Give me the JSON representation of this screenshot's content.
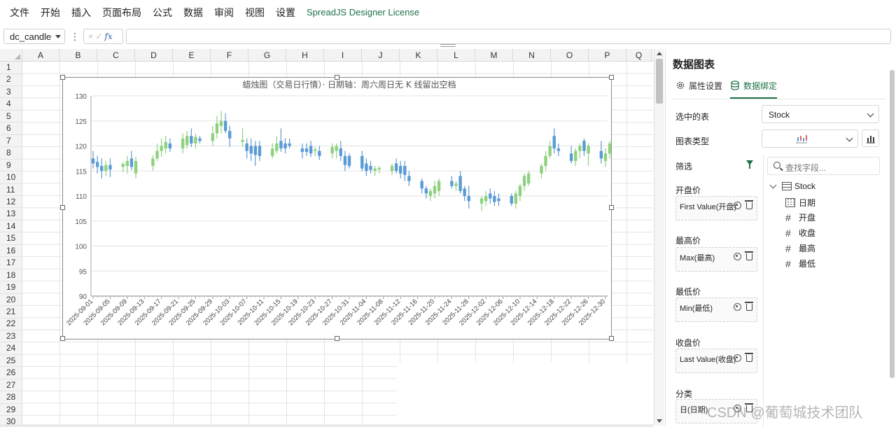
{
  "menu": {
    "items": [
      "文件",
      "开始",
      "插入",
      "页面布局",
      "公式",
      "数据",
      "审阅",
      "视图",
      "设置"
    ],
    "license": "SpreadJS Designer License"
  },
  "formula_bar": {
    "name_box": "dc_candle",
    "dots": "⋮",
    "cancel": "×",
    "confirm": "✓",
    "fx": "fx",
    "formula": ""
  },
  "sheet": {
    "columns": [
      "A",
      "B",
      "C",
      "D",
      "E",
      "F",
      "G",
      "H",
      "I",
      "J",
      "K",
      "L",
      "M",
      "N",
      "O",
      "P",
      "Q"
    ],
    "rows": [
      "1",
      "2",
      "3",
      "4",
      "5",
      "6",
      "7",
      "8",
      "9",
      "10",
      "11",
      "12",
      "13",
      "14",
      "15",
      "16",
      "17",
      "18",
      "19",
      "20",
      "21",
      "22",
      "23",
      "24",
      "25",
      "26",
      "27",
      "28",
      "29",
      "30"
    ]
  },
  "chart_data": {
    "type": "candlestick",
    "title": "蜡烛图（交易日行情）· 日期轴：周六周日无 K 线留出空档",
    "ylim": [
      90,
      130
    ],
    "y_ticks": [
      90,
      95,
      100,
      105,
      110,
      115,
      120,
      125,
      130
    ],
    "x_ticks": [
      "2025-09-01",
      "2025-09-05",
      "2025-09-09",
      "2025-09-13",
      "2025-09-17",
      "2025-09-21",
      "2025-09-25",
      "2025-09-29",
      "2025-10-03",
      "2025-10-07",
      "2025-10-11",
      "2025-10-15",
      "2025-10-19",
      "2025-10-23",
      "2025-10-27",
      "2025-10-31",
      "2025-11-04",
      "2025-11-08",
      "2025-11-12",
      "2025-11-16",
      "2025-11-20",
      "2025-11-24",
      "2025-11-28",
      "2025-12-02",
      "2025-12-06",
      "2025-12-10",
      "2025-12-14",
      "2025-12-18",
      "2025-12-22",
      "2025-12-26",
      "2025-12-30"
    ],
    "date_start": "2025-09-01",
    "colors": {
      "up": "#8fd17f",
      "down": "#5b9bd5",
      "grid": "#e3e3e3",
      "axis": "#555555"
    },
    "candles": [
      {
        "d": "2025-09-01",
        "o": 117.5,
        "h": 119,
        "l": 115.5,
        "c": 116.5
      },
      {
        "d": "2025-09-02",
        "o": 116.8,
        "h": 118,
        "l": 114.5,
        "c": 115.8
      },
      {
        "d": "2025-09-03",
        "o": 116.0,
        "h": 117.5,
        "l": 113.5,
        "c": 115.0
      },
      {
        "d": "2025-09-04",
        "o": 115.0,
        "h": 117.0,
        "l": 114.0,
        "c": 116.2
      },
      {
        "d": "2025-09-05",
        "o": 116.2,
        "h": 117.5,
        "l": 113.8,
        "c": 115.3
      },
      {
        "d": "2025-09-08",
        "o": 115.8,
        "h": 116.8,
        "l": 114.8,
        "c": 116.4
      },
      {
        "d": "2025-09-09",
        "o": 116.0,
        "h": 118.0,
        "l": 114.5,
        "c": 117.0
      },
      {
        "d": "2025-09-10",
        "o": 117.5,
        "h": 119.0,
        "l": 115.2,
        "c": 115.8
      },
      {
        "d": "2025-09-11",
        "o": 114.5,
        "h": 117.8,
        "l": 113.5,
        "c": 117.0
      },
      {
        "d": "2025-09-15",
        "o": 116.0,
        "h": 118.2,
        "l": 115.0,
        "c": 117.5
      },
      {
        "d": "2025-09-16",
        "o": 117.5,
        "h": 120.5,
        "l": 117.0,
        "c": 119.0
      },
      {
        "d": "2025-09-17",
        "o": 119.0,
        "h": 121.5,
        "l": 117.8,
        "c": 120.0
      },
      {
        "d": "2025-09-18",
        "o": 119.5,
        "h": 122.0,
        "l": 118.5,
        "c": 120.8
      },
      {
        "d": "2025-09-19",
        "o": 120.5,
        "h": 121.5,
        "l": 118.8,
        "c": 119.5
      },
      {
        "d": "2025-09-22",
        "o": 119.5,
        "h": 122.5,
        "l": 118.5,
        "c": 121.5
      },
      {
        "d": "2025-09-23",
        "o": 120.2,
        "h": 123.0,
        "l": 119.5,
        "c": 122.0
      },
      {
        "d": "2025-09-24",
        "o": 122.0,
        "h": 123.5,
        "l": 119.8,
        "c": 120.5
      },
      {
        "d": "2025-09-25",
        "o": 120.5,
        "h": 122.5,
        "l": 119.5,
        "c": 121.8
      },
      {
        "d": "2025-09-26",
        "o": 121.5,
        "h": 122.0,
        "l": 120.5,
        "c": 121.0
      },
      {
        "d": "2025-09-29",
        "o": 121.0,
        "h": 124.0,
        "l": 120.0,
        "c": 122.5
      },
      {
        "d": "2025-09-30",
        "o": 122.5,
        "h": 126.0,
        "l": 121.5,
        "c": 124.5
      },
      {
        "d": "2025-10-01",
        "o": 124.0,
        "h": 127.0,
        "l": 122.5,
        "c": 125.0
      },
      {
        "d": "2025-10-02",
        "o": 125.0,
        "h": 126.5,
        "l": 122.5,
        "c": 123.0
      },
      {
        "d": "2025-10-03",
        "o": 123.0,
        "h": 124.0,
        "l": 119.8,
        "c": 121.5
      },
      {
        "d": "2025-10-06",
        "o": 120.8,
        "h": 123.5,
        "l": 119.8,
        "c": 121.2
      },
      {
        "d": "2025-10-07",
        "o": 120.5,
        "h": 121.5,
        "l": 117.5,
        "c": 119.0
      },
      {
        "d": "2025-10-08",
        "o": 120.0,
        "h": 121.5,
        "l": 117.0,
        "c": 118.5
      },
      {
        "d": "2025-10-09",
        "o": 120.0,
        "h": 121.0,
        "l": 116.0,
        "c": 118.2
      },
      {
        "d": "2025-10-10",
        "o": 120.0,
        "h": 121.0,
        "l": 117.0,
        "c": 118.0
      },
      {
        "d": "2025-10-13",
        "o": 118.0,
        "h": 120.5,
        "l": 117.5,
        "c": 119.5
      },
      {
        "d": "2025-10-14",
        "o": 119.0,
        "h": 122.0,
        "l": 118.5,
        "c": 120.5
      },
      {
        "d": "2025-10-15",
        "o": 121.0,
        "h": 123.5,
        "l": 118.8,
        "c": 119.5
      },
      {
        "d": "2025-10-16",
        "o": 120.5,
        "h": 121.5,
        "l": 118.5,
        "c": 119.5
      },
      {
        "d": "2025-10-17",
        "o": 120.5,
        "h": 121.5,
        "l": 119.5,
        "c": 120.0
      },
      {
        "d": "2025-10-20",
        "o": 119.5,
        "h": 120.5,
        "l": 117.5,
        "c": 118.8
      },
      {
        "d": "2025-10-21",
        "o": 119.5,
        "h": 120.5,
        "l": 118.0,
        "c": 118.8
      },
      {
        "d": "2025-10-22",
        "o": 120.0,
        "h": 121.0,
        "l": 117.8,
        "c": 118.5
      },
      {
        "d": "2025-10-23",
        "o": 119.0,
        "h": 119.8,
        "l": 118.0,
        "c": 119.3
      },
      {
        "d": "2025-10-24",
        "o": 119.0,
        "h": 120.0,
        "l": 117.2,
        "c": 118.0
      },
      {
        "d": "2025-10-27",
        "o": 118.5,
        "h": 120.5,
        "l": 117.5,
        "c": 119.8
      },
      {
        "d": "2025-10-28",
        "o": 119.0,
        "h": 120.5,
        "l": 117.5,
        "c": 120.0
      },
      {
        "d": "2025-10-29",
        "o": 119.5,
        "h": 121.0,
        "l": 117.0,
        "c": 118.0
      },
      {
        "d": "2025-10-30",
        "o": 118.0,
        "h": 119.0,
        "l": 115.0,
        "c": 116.2
      },
      {
        "d": "2025-10-31",
        "o": 118.0,
        "h": 118.5,
        "l": 115.5,
        "c": 116.0
      },
      {
        "d": "2025-11-03",
        "o": 118.0,
        "h": 119.0,
        "l": 115.0,
        "c": 115.5
      },
      {
        "d": "2025-11-04",
        "o": 116.5,
        "h": 117.5,
        "l": 114.0,
        "c": 115.0
      },
      {
        "d": "2025-11-05",
        "o": 116.0,
        "h": 117.0,
        "l": 114.5,
        "c": 115.2
      },
      {
        "d": "2025-11-06",
        "o": 115.0,
        "h": 116.0,
        "l": 114.0,
        "c": 115.5
      },
      {
        "d": "2025-11-07",
        "o": 115.3,
        "h": 116.0,
        "l": 114.5,
        "c": 115.6
      },
      {
        "d": "2025-11-10",
        "o": 115.0,
        "h": 116.5,
        "l": 114.2,
        "c": 116.0
      },
      {
        "d": "2025-11-11",
        "o": 116.5,
        "h": 117.5,
        "l": 114.5,
        "c": 115.0
      },
      {
        "d": "2025-11-12",
        "o": 116.0,
        "h": 117.0,
        "l": 113.5,
        "c": 114.5
      },
      {
        "d": "2025-11-13",
        "o": 116.0,
        "h": 117.0,
        "l": 113.0,
        "c": 114.2
      },
      {
        "d": "2025-11-14",
        "o": 114.0,
        "h": 115.0,
        "l": 112.0,
        "c": 113.0
      },
      {
        "d": "2025-11-17",
        "o": 113.0,
        "h": 113.5,
        "l": 110.5,
        "c": 111.5
      },
      {
        "d": "2025-11-18",
        "o": 111.5,
        "h": 112.0,
        "l": 109.5,
        "c": 110.5
      },
      {
        "d": "2025-11-19",
        "o": 110.0,
        "h": 111.5,
        "l": 109.0,
        "c": 111.0
      },
      {
        "d": "2025-11-20",
        "o": 110.5,
        "h": 113.0,
        "l": 109.5,
        "c": 112.0
      },
      {
        "d": "2025-11-21",
        "o": 111.0,
        "h": 113.5,
        "l": 110.0,
        "c": 113.0
      },
      {
        "d": "2025-11-24",
        "o": 113.0,
        "h": 114.0,
        "l": 111.5,
        "c": 112.0
      },
      {
        "d": "2025-11-25",
        "o": 112.0,
        "h": 113.0,
        "l": 111.0,
        "c": 112.5
      },
      {
        "d": "2025-11-26",
        "o": 114.0,
        "h": 115.0,
        "l": 110.5,
        "c": 111.0
      },
      {
        "d": "2025-11-27",
        "o": 111.5,
        "h": 112.0,
        "l": 109.0,
        "c": 110.0
      },
      {
        "d": "2025-11-28",
        "o": 110.0,
        "h": 112.0,
        "l": 107.5,
        "c": 109.0
      },
      {
        "d": "2025-12-01",
        "o": 108.5,
        "h": 110.0,
        "l": 107.0,
        "c": 109.5
      },
      {
        "d": "2025-12-02",
        "o": 109.0,
        "h": 111.0,
        "l": 108.0,
        "c": 110.0
      },
      {
        "d": "2025-12-03",
        "o": 110.5,
        "h": 111.5,
        "l": 108.5,
        "c": 109.5
      },
      {
        "d": "2025-12-04",
        "o": 110.0,
        "h": 111.0,
        "l": 108.0,
        "c": 108.8
      },
      {
        "d": "2025-12-05",
        "o": 109.5,
        "h": 110.5,
        "l": 108.0,
        "c": 109.0
      },
      {
        "d": "2025-12-08",
        "o": 110.0,
        "h": 110.5,
        "l": 108.0,
        "c": 108.5
      },
      {
        "d": "2025-12-09",
        "o": 108.5,
        "h": 111.0,
        "l": 107.5,
        "c": 110.5
      },
      {
        "d": "2025-12-10",
        "o": 110.0,
        "h": 112.5,
        "l": 109.0,
        "c": 112.0
      },
      {
        "d": "2025-12-11",
        "o": 112.0,
        "h": 114.5,
        "l": 111.0,
        "c": 114.0
      },
      {
        "d": "2025-12-12",
        "o": 112.5,
        "h": 115.0,
        "l": 112.0,
        "c": 114.5
      },
      {
        "d": "2025-12-15",
        "o": 114.5,
        "h": 116.5,
        "l": 113.5,
        "c": 116.0
      },
      {
        "d": "2025-12-16",
        "o": 116.0,
        "h": 119.0,
        "l": 115.0,
        "c": 118.0
      },
      {
        "d": "2025-12-17",
        "o": 118.0,
        "h": 121.0,
        "l": 117.5,
        "c": 120.0
      },
      {
        "d": "2025-12-18",
        "o": 122.0,
        "h": 123.5,
        "l": 118.5,
        "c": 119.5
      },
      {
        "d": "2025-12-19",
        "o": 119.5,
        "h": 120.5,
        "l": 118.0,
        "c": 119.0
      },
      {
        "d": "2025-12-22",
        "o": 118.5,
        "h": 120.0,
        "l": 116.5,
        "c": 117.0
      },
      {
        "d": "2025-12-23",
        "o": 117.0,
        "h": 119.5,
        "l": 116.0,
        "c": 119.0
      },
      {
        "d": "2025-12-24",
        "o": 119.0,
        "h": 120.5,
        "l": 117.5,
        "c": 120.0
      },
      {
        "d": "2025-12-25",
        "o": 121.0,
        "h": 121.5,
        "l": 118.0,
        "c": 119.0
      },
      {
        "d": "2025-12-26",
        "o": 118.5,
        "h": 120.5,
        "l": 116.0,
        "c": 120.0
      },
      {
        "d": "2025-12-29",
        "o": 119.0,
        "h": 121.0,
        "l": 116.5,
        "c": 117.5
      },
      {
        "d": "2025-12-30",
        "o": 117.0,
        "h": 119.5,
        "l": 115.8,
        "c": 118.5
      },
      {
        "d": "2025-12-31",
        "o": 118.5,
        "h": 121.0,
        "l": 117.5,
        "c": 120.5
      }
    ]
  },
  "panel": {
    "title": "数据图表",
    "tabs": [
      "属性设置",
      "数据绑定"
    ],
    "selected_table_label": "选中的表",
    "selected_table_value": "Stock",
    "chart_type_label": "图表类型",
    "filter_label": "筛选",
    "search_placeholder": "查找字段...",
    "tree_root": "Stock",
    "fields": [
      "日期",
      "开盘",
      "收盘",
      "最高",
      "最低"
    ],
    "bindings": [
      {
        "label": "开盘价",
        "value": "First Value(开盘)"
      },
      {
        "label": "最高价",
        "value": "Max(最高)"
      },
      {
        "label": "最低价",
        "value": "Min(最低)"
      },
      {
        "label": "收盘价",
        "value": "Last Value(收盘)"
      },
      {
        "label": "分类",
        "value": "日(日期)"
      }
    ]
  },
  "watermark": "CSDN @葡萄城技术团队"
}
